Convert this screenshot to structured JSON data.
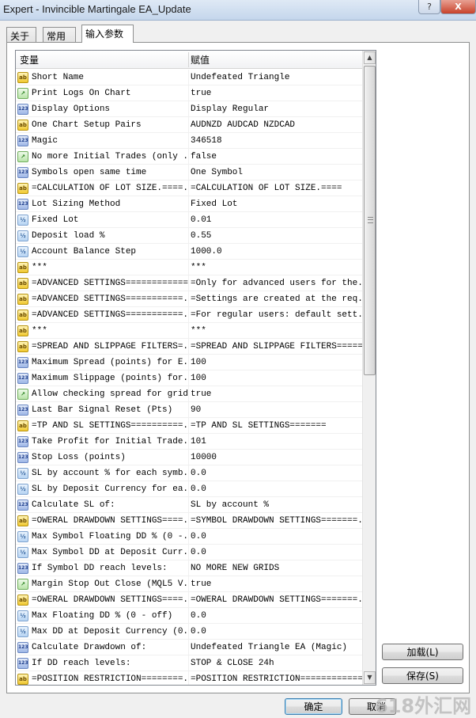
{
  "window": {
    "title": "Expert - Invincible Martingale EA_Update",
    "help_label": "?",
    "close_label": "X"
  },
  "tabs": [
    {
      "label": "关于"
    },
    {
      "label": "常用"
    },
    {
      "label": "输入参数"
    }
  ],
  "grid": {
    "col_variable": "变量",
    "col_value": "赋值",
    "rows": [
      {
        "type": "ab",
        "name": "Short Name",
        "value": "Undefeated Triangle"
      },
      {
        "type": "bool",
        "name": "Print Logs On Chart",
        "value": "true"
      },
      {
        "type": "123",
        "name": "Display Options",
        "value": "Display Regular"
      },
      {
        "type": "ab",
        "name": "One Chart Setup Pairs",
        "value": "AUDNZD AUDCAD NZDCAD"
      },
      {
        "type": "123",
        "name": "Magic",
        "value": "346518"
      },
      {
        "type": "bool",
        "name": "No more Initial Trades (only ...",
        "value": "false"
      },
      {
        "type": "123",
        "name": "Symbols open same time",
        "value": "One Symbol"
      },
      {
        "type": "ab",
        "name": "=CALCULATION OF LOT SIZE.====...",
        "value": "=CALCULATION OF LOT SIZE.===="
      },
      {
        "type": "123",
        "name": "Lot Sizing Method",
        "value": "Fixed Lot"
      },
      {
        "type": "v2",
        "name": "Fixed Lot",
        "value": "0.01"
      },
      {
        "type": "v2",
        "name": "Deposit load %",
        "value": "0.55"
      },
      {
        "type": "v2",
        "name": "Account Balance Step",
        "value": "1000.0"
      },
      {
        "type": "ab",
        "name": "***",
        "value": "***"
      },
      {
        "type": "ab",
        "name": "=ADVANCED SETTINGS==============",
        "value": "=Only for advanced users for the..."
      },
      {
        "type": "ab",
        "name": "=ADVANCED SETTINGS===========...",
        "value": "=Settings are created at the req..."
      },
      {
        "type": "ab",
        "name": "=ADVANCED SETTINGS===========...",
        "value": "=For regular users: default sett..."
      },
      {
        "type": "ab",
        "name": "***",
        "value": "***"
      },
      {
        "type": "ab",
        "name": "=SPREAD AND SLIPPAGE FILTERS=...",
        "value": "=SPREAD AND SLIPPAGE FILTERS======="
      },
      {
        "type": "123",
        "name": "Maximum Spread (points) for E...",
        "value": "100"
      },
      {
        "type": "123",
        "name": "Maximum Slippage (points) for...",
        "value": "100"
      },
      {
        "type": "bool",
        "name": "Allow checking spread for grid",
        "value": "true"
      },
      {
        "type": "123",
        "name": "Last Bar Signal Reset (Pts)",
        "value": "90"
      },
      {
        "type": "ab",
        "name": "=TP AND SL SETTINGS==========...",
        "value": "=TP AND SL SETTINGS======="
      },
      {
        "type": "123",
        "name": "Take Profit for Initial Trade...",
        "value": "101"
      },
      {
        "type": "123",
        "name": "Stop Loss (points)",
        "value": "10000"
      },
      {
        "type": "v2",
        "name": "SL by account % for each symb...",
        "value": "0.0"
      },
      {
        "type": "v2",
        "name": "SL by Deposit Currency for ea...",
        "value": "0.0"
      },
      {
        "type": "123",
        "name": "Calculate SL of:",
        "value": "SL by account %"
      },
      {
        "type": "ab",
        "name": "=OWERAL DRAWDOWN SETTINGS====...",
        "value": "=SYMBOL DRAWDOWN SETTINGS=======..."
      },
      {
        "type": "v2",
        "name": "Max Symbol Floating DD % (0 -...",
        "value": "0.0"
      },
      {
        "type": "v2",
        "name": "Max Symbol DD at Deposit Curr...",
        "value": "0.0"
      },
      {
        "type": "123",
        "name": "If Symbol DD reach levels:",
        "value": "NO MORE NEW GRIDS"
      },
      {
        "type": "bool",
        "name": "Margin Stop Out Close (MQL5 V...",
        "value": "true"
      },
      {
        "type": "ab",
        "name": "=OWERAL DRAWDOWN SETTINGS====...",
        "value": "=OWERAL DRAWDOWN SETTINGS=======..."
      },
      {
        "type": "v2",
        "name": "Max Floating DD % (0 - off)",
        "value": "0.0"
      },
      {
        "type": "v2",
        "name": "Max DD at Deposit Currency (0...",
        "value": "0.0"
      },
      {
        "type": "123",
        "name": "Calculate Drawdown of:",
        "value": "Undefeated Triangle EA (Magic)"
      },
      {
        "type": "123",
        "name": "If DD reach levels:",
        "value": "STOP & CLOSE 24h"
      },
      {
        "type": "ab",
        "name": "=POSITION RESTRICTION========...",
        "value": "=POSITION RESTRICTION=============="
      }
    ]
  },
  "icons": {
    "ab": "string-type-icon",
    "123": "enum-type-icon",
    "v2": "double-type-icon",
    "bool": "bool-type-icon"
  },
  "icon_text": {
    "ab": "ab",
    "123": "123",
    "v2": "½",
    "bool": "↗"
  },
  "buttons": {
    "load": "加载(L)",
    "save": "保存(S)",
    "ok": "确定",
    "cancel": "取消"
  },
  "watermark": "618外汇网"
}
